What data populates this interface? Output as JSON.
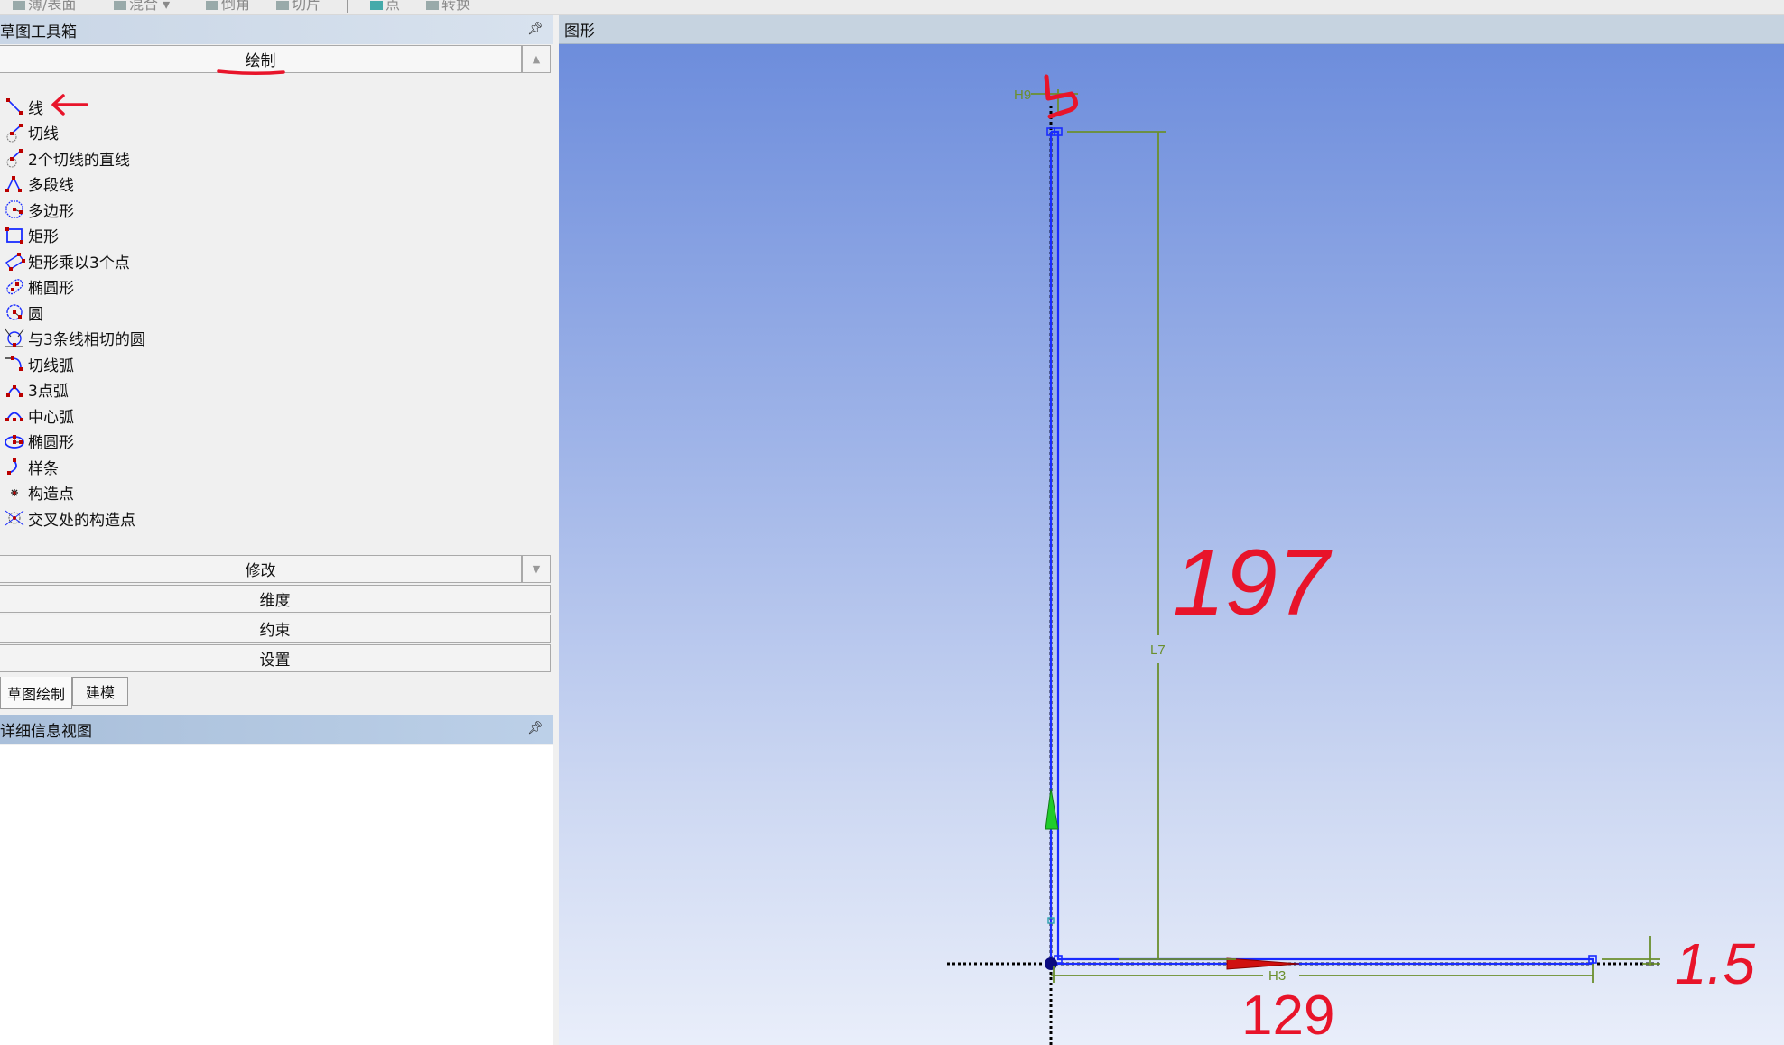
{
  "toolbar": {
    "items": [
      {
        "label": "薄/表面",
        "icon": "thin-surface-icon"
      },
      {
        "label": "混合",
        "icon": "blend-icon"
      },
      {
        "label": "倒角",
        "icon": "chamfer-icon"
      },
      {
        "label": "切片",
        "icon": "slice-icon"
      },
      {
        "label": "点",
        "icon": "point-icon"
      },
      {
        "label": "转换",
        "icon": "conversion-icon"
      }
    ]
  },
  "sketch_toolbox": {
    "title": "草图工具箱",
    "pin_icon": "pin-icon",
    "draw_section": "绘制",
    "draw_items": [
      {
        "label": "线",
        "icon": "line-icon"
      },
      {
        "label": "切线",
        "icon": "tangent-line-icon"
      },
      {
        "label": "2个切线的直线",
        "icon": "line-tangent-two-icon"
      },
      {
        "label": "多段线",
        "icon": "polyline-icon"
      },
      {
        "label": "多边形",
        "icon": "polygon-icon"
      },
      {
        "label": "矩形",
        "icon": "rectangle-icon"
      },
      {
        "label": "矩形乘以3个点",
        "icon": "rectangle-3pt-icon"
      },
      {
        "label": "椭圆形",
        "icon": "oval-icon"
      },
      {
        "label": "圆",
        "icon": "circle-icon"
      },
      {
        "label": "与3条线相切的圆",
        "icon": "circle-tangent-3-icon"
      },
      {
        "label": "切线弧",
        "icon": "tangent-arc-icon"
      },
      {
        "label": "3点弧",
        "icon": "arc-3pt-icon"
      },
      {
        "label": "中心弧",
        "icon": "center-arc-icon"
      },
      {
        "label": "椭圆形",
        "icon": "ellipse-icon"
      },
      {
        "label": "样条",
        "icon": "spline-icon"
      },
      {
        "label": "构造点",
        "icon": "construction-point-icon"
      },
      {
        "label": "交叉处的构造点",
        "icon": "intersection-point-icon"
      }
    ],
    "sections": [
      "修改",
      "维度",
      "约束",
      "设置"
    ]
  },
  "tabs": [
    {
      "label": "草图绘制",
      "active": true
    },
    {
      "label": "建模",
      "active": false
    }
  ],
  "details": {
    "title": "详细信息视图"
  },
  "graphics": {
    "title": "图形",
    "dimensions": {
      "h9": "H9",
      "l7": "L7",
      "h3": "H3"
    },
    "annotations": {
      "top": "5",
      "vertical": "197",
      "horizontal": "129",
      "thickness": "1.5"
    },
    "colors": {
      "sketch_line": "#1a2cff",
      "dimension": "#6b8f2e",
      "annotation": "#e8142a",
      "axis": "#000000"
    }
  }
}
